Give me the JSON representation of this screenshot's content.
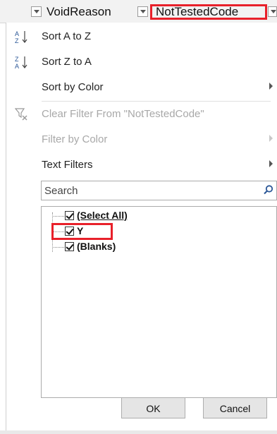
{
  "header": {
    "col1_label": "VoidReason",
    "col2_label": "NotTestedCode"
  },
  "menu": {
    "sort_az": "Sort A to Z",
    "sort_za": "Sort Z to A",
    "sort_by_color": "Sort by Color",
    "clear_filter": "Clear Filter From \"NotTestedCode\"",
    "filter_by_color": "Filter by Color",
    "text_filters": "Text Filters"
  },
  "search": {
    "placeholder": "Search"
  },
  "list": {
    "items": [
      {
        "label": "(Select All)",
        "checked": true
      },
      {
        "label": "Y",
        "checked": true
      },
      {
        "label": "(Blanks)",
        "checked": true
      }
    ]
  },
  "buttons": {
    "ok": "OK",
    "cancel": "Cancel"
  },
  "colors": {
    "highlight": "#e8202a",
    "icon_blue": "#2b5797"
  }
}
